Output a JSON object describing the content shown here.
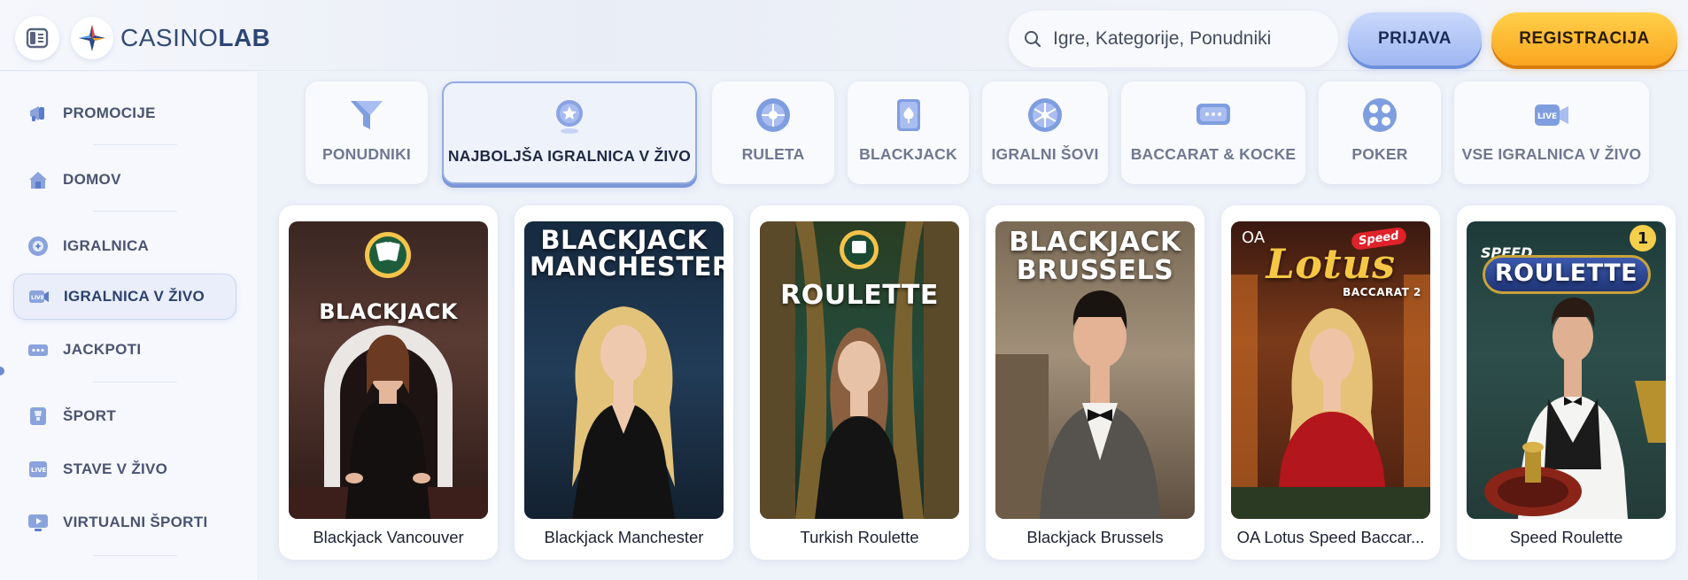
{
  "header": {
    "logo_light": "CASINO",
    "logo_bold": "LAB",
    "search_placeholder": "Igre, Kategorije, Ponudniki",
    "login_label": "PRIJAVA",
    "register_label": "REGISTRACIJA"
  },
  "sidebar": {
    "items": [
      {
        "label": "PROMOCIJE",
        "icon": "megaphone-icon"
      },
      {
        "label": "DOMOV",
        "icon": "home-icon"
      },
      {
        "label": "IGRALNICA",
        "icon": "chip-icon"
      },
      {
        "label": "IGRALNICA V ŽIVO",
        "icon": "live-icon",
        "active": true
      },
      {
        "label": "JACKPOTI",
        "icon": "jackpot-icon"
      },
      {
        "label": "ŠPORT",
        "icon": "trophy-icon"
      },
      {
        "label": "STAVE V ŽIVO",
        "icon": "live-bets-icon"
      },
      {
        "label": "VIRTUALNI ŠPORTI",
        "icon": "monitor-icon"
      }
    ]
  },
  "categories": [
    {
      "label": "PONUDNIKI",
      "icon": "filter-icon"
    },
    {
      "label": "NAJBOLJŠA IGRALNICA V ŽIVO",
      "icon": "star-medal-icon",
      "active": true
    },
    {
      "label": "RULETA",
      "icon": "roulette-icon"
    },
    {
      "label": "BLACKJACK",
      "icon": "card-icon"
    },
    {
      "label": "IGRALNI ŠOVI",
      "icon": "wheel-icon"
    },
    {
      "label": "BACCARAT & KOCKE",
      "icon": "baccarat-icon"
    },
    {
      "label": "POKER",
      "icon": "poker-icon"
    },
    {
      "label": "VSE IGRALNICA V ŽIVO",
      "icon": "live-camera-icon"
    }
  ],
  "games": [
    {
      "name": "Blackjack Vancouver",
      "thumb_title": "BLACKJACK"
    },
    {
      "name": "Blackjack Manchester",
      "thumb_title": "BLACKJACK MANCHESTER"
    },
    {
      "name": "Turkish Roulette",
      "thumb_title": "ROULETTE"
    },
    {
      "name": "Blackjack Brussels",
      "thumb_title": "BLACKJACK BRUSSELS"
    },
    {
      "name": "OA Lotus Speed Baccar...",
      "thumb_title": "Lotus",
      "thumb_sub": "BACCARAT 2",
      "thumb_brand": "OA",
      "thumb_badge": "Speed"
    },
    {
      "name": "Speed Roulette",
      "thumb_title": "ROULETTE",
      "thumb_badge": "SPEED",
      "thumb_num": "1"
    }
  ],
  "colors": {
    "accent_blue": "#9fb7f2",
    "accent_orange": "#fba51f",
    "sidebar_bg": "#f6f8fd"
  }
}
